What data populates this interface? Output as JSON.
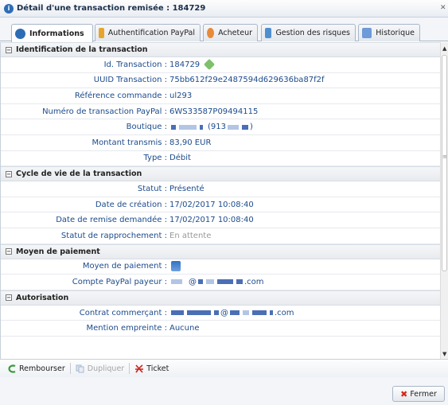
{
  "window": {
    "title": "Détail d'une transaction remisée : 184729"
  },
  "tabs": [
    {
      "label": "Informations",
      "icon": "info-icon",
      "color": "#2d6db5"
    },
    {
      "label": "Authentification PayPal",
      "icon": "user-key-icon",
      "color": "#e7a52d"
    },
    {
      "label": "Acheteur",
      "icon": "person-icon",
      "color": "#e98a3a"
    },
    {
      "label": "Gestion des risques",
      "icon": "chart-icon",
      "color": "#4f8fcf"
    },
    {
      "label": "Historique",
      "icon": "document-icon",
      "color": "#6d9ad8"
    }
  ],
  "sections": {
    "identification": {
      "title": "Identification de la transaction",
      "rows": [
        {
          "label": "Id. Transaction :",
          "value": "184729"
        },
        {
          "label": "UUID Transaction :",
          "value": "75bb612f29e2487594d629636ba87f2f"
        },
        {
          "label": "Référence commande :",
          "value": "ul293"
        },
        {
          "label": "Numéro de transaction PayPal :",
          "value": "6WS33587P09494115"
        },
        {
          "label": "Boutique :",
          "value": "(913"
        },
        {
          "label": "Montant transmis :",
          "value": "83,90 EUR"
        },
        {
          "label": "Type :",
          "value": "Débit"
        }
      ]
    },
    "cycle": {
      "title": "Cycle de vie de la transaction",
      "rows": [
        {
          "label": "Statut :",
          "value": "Présenté"
        },
        {
          "label": "Date de création :",
          "value": "17/02/2017 10:08:40"
        },
        {
          "label": "Date de remise demandée :",
          "value": "17/02/2017 10:08:40"
        },
        {
          "label": "Statut de rapprochement :",
          "value": "En attente"
        }
      ]
    },
    "payment": {
      "title": "Moyen de paiement",
      "rows": [
        {
          "label": "Moyen de paiement :",
          "value": ""
        },
        {
          "label": "Compte PayPal payeur :",
          "value_prefix": "@",
          "value_suffix": ".com"
        }
      ]
    },
    "auth": {
      "title": "Autorisation",
      "rows": [
        {
          "label": "Contrat commerçant :",
          "value_prefix": "@",
          "value_suffix": ".com"
        },
        {
          "label": "Mention empreinte :",
          "value": "Aucune"
        }
      ]
    }
  },
  "toolbar": {
    "rembourser": "Rembourser",
    "dupliquer": "Dupliquer",
    "ticket": "Ticket"
  },
  "footer": {
    "fermer": "Fermer"
  }
}
